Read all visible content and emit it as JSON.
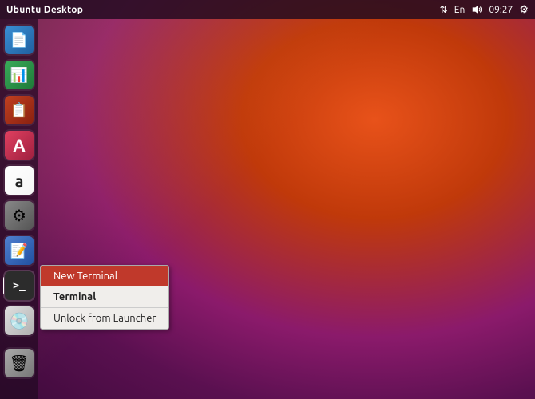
{
  "panel": {
    "title": "Ubuntu Desktop",
    "time": "09:27",
    "language": "En",
    "sort_icon": "⇅"
  },
  "launcher": {
    "items": [
      {
        "id": "writer",
        "label": "LibreOffice Writer",
        "type": "writer"
      },
      {
        "id": "calc",
        "label": "LibreOffice Calc",
        "type": "calc"
      },
      {
        "id": "impress",
        "label": "LibreOffice Impress",
        "type": "impress"
      },
      {
        "id": "font",
        "label": "Font Manager",
        "type": "font",
        "char": "A"
      },
      {
        "id": "amazon",
        "label": "Amazon",
        "type": "amazon",
        "char": "a"
      },
      {
        "id": "settings",
        "label": "System Settings",
        "type": "settings"
      },
      {
        "id": "editor",
        "label": "Text Editor",
        "type": "editor"
      },
      {
        "id": "terminal",
        "label": "Terminal",
        "type": "terminal",
        "active": true
      },
      {
        "id": "dvd",
        "label": "DVD Player",
        "type": "dvd"
      },
      {
        "id": "trash",
        "label": "Trash",
        "type": "trash"
      }
    ]
  },
  "context_menu": {
    "items": [
      {
        "id": "new-terminal",
        "label": "New Terminal",
        "highlighted": true
      },
      {
        "id": "terminal-label",
        "label": "Terminal",
        "bold": true
      },
      {
        "id": "unlock",
        "label": "Unlock from Launcher"
      }
    ]
  }
}
